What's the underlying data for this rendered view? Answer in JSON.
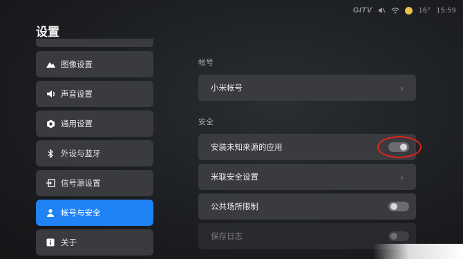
{
  "status": {
    "brand": "GITV",
    "temperature": "16°",
    "time": "15:59"
  },
  "page": {
    "title": "设置"
  },
  "sidebar": {
    "items": [
      {
        "label": "图像设置",
        "icon": "mountain-icon"
      },
      {
        "label": "声音设置",
        "icon": "speaker-icon"
      },
      {
        "label": "通用设置",
        "icon": "gear-icon"
      },
      {
        "label": "外设与蓝牙",
        "icon": "bluetooth-icon"
      },
      {
        "label": "信号源设置",
        "icon": "input-source-icon"
      },
      {
        "label": "帐号与安全",
        "icon": "user-icon"
      },
      {
        "label": "关于",
        "icon": "info-icon"
      }
    ]
  },
  "account": {
    "section_label": "帐号",
    "mi_account_label": "小米帐号"
  },
  "security": {
    "section_label": "安全",
    "unknown_sources_label": "安装未知来源的应用",
    "mi_security_label": "米联安全设置",
    "public_restriction_label": "公共场所限制",
    "save_log_label": "保存日志"
  }
}
